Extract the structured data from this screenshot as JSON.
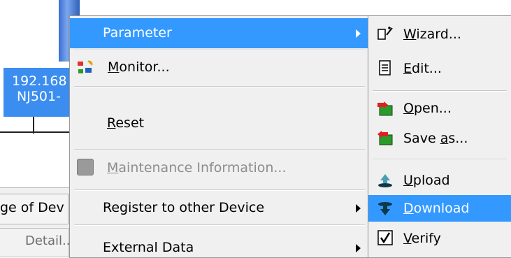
{
  "background": {
    "device_label_line1": "192.168",
    "device_label_line2": "NJ501-",
    "tab_label": "ge of Dev",
    "detail_button": "Detail..."
  },
  "context_menu": {
    "items": [
      {
        "pre": "",
        "ul": "",
        "post": "Parameter",
        "has_submenu": true,
        "selected": true
      },
      {
        "pre": "",
        "ul": "M",
        "post": "onitor...",
        "icon": "monitor-icon"
      },
      {
        "pre": "",
        "ul": "R",
        "post": "eset"
      },
      {
        "pre": "",
        "ul": "M",
        "post": "aintenance Information...",
        "icon": "maintenance-icon",
        "disabled": true
      },
      {
        "pre": "",
        "ul": "",
        "post": "Register to other Device",
        "has_submenu": true
      },
      {
        "pre": "",
        "ul": "",
        "post": "External Data",
        "has_submenu": true
      }
    ]
  },
  "submenu": {
    "items": [
      {
        "pre": "",
        "ul": "W",
        "post": "izard...",
        "icon": "wizard-icon"
      },
      {
        "pre": "",
        "ul": "E",
        "post": "dit...",
        "icon": "edit-icon"
      },
      {
        "pre": "",
        "ul": "O",
        "post": "pen...",
        "icon": "open-icon"
      },
      {
        "pre": "Save ",
        "ul": "a",
        "post": "s...",
        "icon": "save-as-icon"
      },
      {
        "pre": "",
        "ul": "U",
        "post": "pload",
        "icon": "upload-icon"
      },
      {
        "pre": "",
        "ul": "D",
        "post": "ownload",
        "icon": "download-icon",
        "selected": true
      },
      {
        "pre": "",
        "ul": "V",
        "post": "erify",
        "icon": "verify-icon"
      }
    ]
  },
  "colors": {
    "highlight": "#3399ff",
    "menu_bg": "#f0f0f0",
    "device_label_bg": "#3c8df0"
  }
}
